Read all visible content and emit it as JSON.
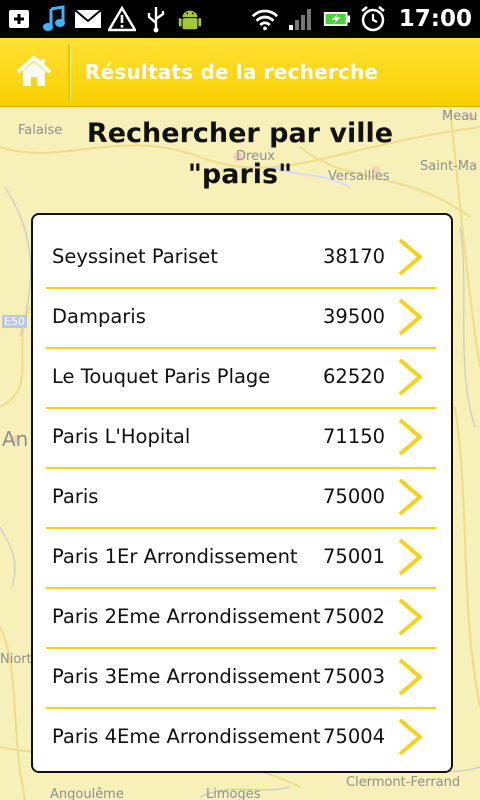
{
  "status_bar": {
    "time": "17:00",
    "left_icons": [
      "usb-plus-icon",
      "music-note-icon",
      "mail-icon",
      "warning-icon",
      "usb-icon",
      "android-icon"
    ],
    "right_icons": [
      "wifi-icon",
      "signal-icon",
      "battery-charging-icon",
      "alarm-icon"
    ]
  },
  "header": {
    "title": "Résultats de la recherche",
    "home_icon": "home-icon",
    "accent_color": "#ffd200"
  },
  "heading": {
    "line1": "Rechercher par ville",
    "line2": "\"paris\""
  },
  "map_labels": [
    "Falaise",
    "Dreux",
    "Versailles",
    "Saint-Ma",
    "Meau",
    "E50",
    "An",
    "Niort",
    "Angoulême",
    "Limoges",
    "Clermont-Ferrand"
  ],
  "results": [
    {
      "name": "Seyssinet Pariset",
      "code": "38170"
    },
    {
      "name": "Damparis",
      "code": "39500"
    },
    {
      "name": "Le Touquet Paris Plage",
      "code": "62520"
    },
    {
      "name": "Paris L'Hopital",
      "code": "71150"
    },
    {
      "name": "Paris",
      "code": "75000"
    },
    {
      "name": "Paris 1Er Arrondissement",
      "code": "75001"
    },
    {
      "name": "Paris 2Eme Arrondissement",
      "code": "75002"
    },
    {
      "name": "Paris 3Eme Arrondissement",
      "code": "75003"
    },
    {
      "name": "Paris 4Eme Arrondissement",
      "code": "75004"
    }
  ]
}
